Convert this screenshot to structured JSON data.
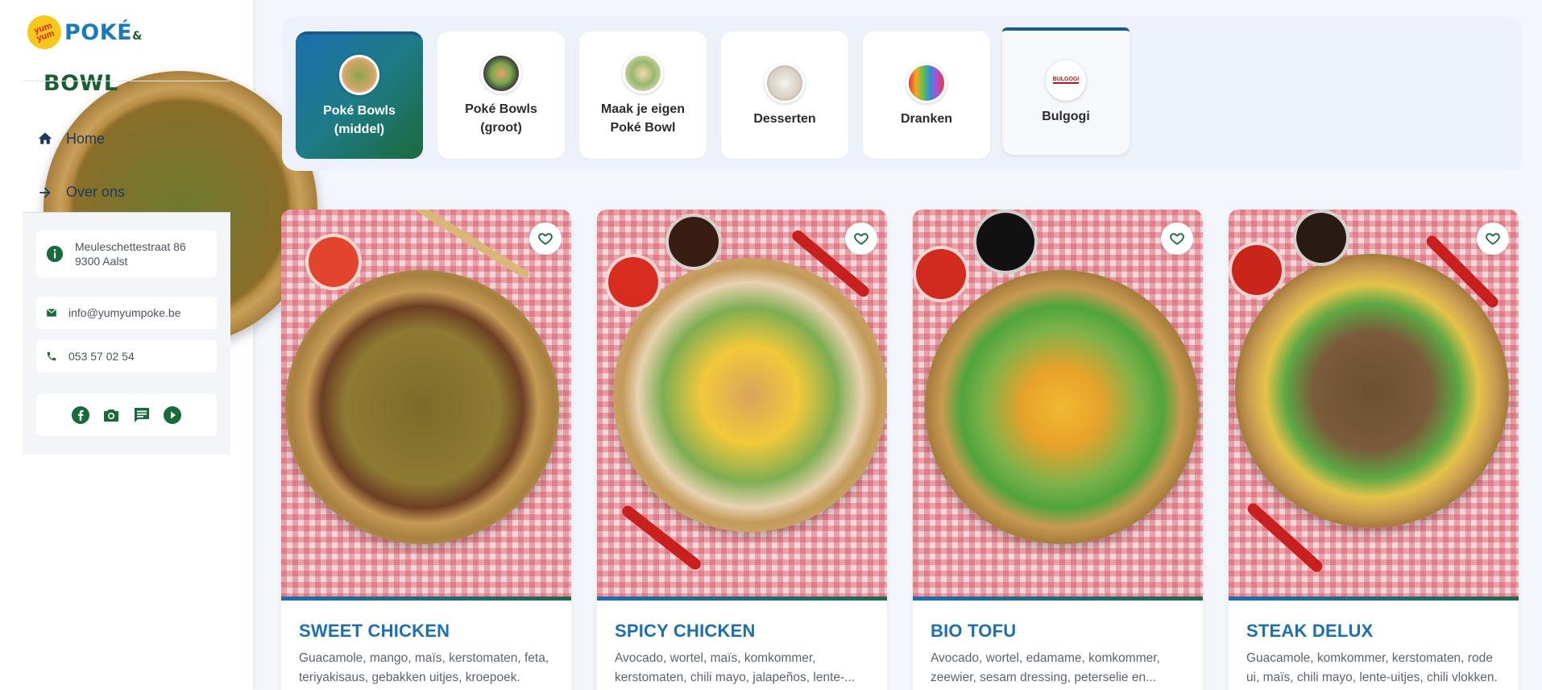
{
  "brand": {
    "mark": "yum yum",
    "name_part1": "POKÉ",
    "amp": "&",
    "name_part2": "BOWL",
    "colors": {
      "blue": "#1b7bb8",
      "green": "#1a5f32",
      "yellow": "#f7c71b",
      "red": "#d6261f"
    }
  },
  "nav": {
    "home": {
      "label": "Home",
      "icon": "home-icon"
    },
    "over": {
      "label": "Over ons",
      "icon": "arrow-right-icon"
    }
  },
  "contact": {
    "address_line1": "Meuleschettestraat 86",
    "address_line2": "9300 Aalst",
    "email": "info@yumyumpoke.be",
    "phone": "053 57 02 54",
    "social": [
      "facebook-icon",
      "camera-icon",
      "chat-icon",
      "play-icon"
    ]
  },
  "categories": [
    {
      "label": "Poké Bowls\n(middel)",
      "active": true
    },
    {
      "label": "Poké Bowls\n(groot)",
      "active": false
    },
    {
      "label": "Maak je eigen\nPoké Bowl",
      "active": false
    },
    {
      "label": "Desserten",
      "active": false
    },
    {
      "label": "Dranken",
      "active": false
    },
    {
      "label": "Bulgogi",
      "active": false
    }
  ],
  "products": [
    {
      "title": "SWEET CHICKEN",
      "desc": "Guacamole, mango, maïs, kerstomaten, feta, teriyakisaus, gebakken uitjes, kroepoek."
    },
    {
      "title": "SPICY CHICKEN",
      "desc": "Avocado, wortel, maïs, komkommer, kerstomaten, chili mayo, jalapeños, lente-..."
    },
    {
      "title": "BIO TOFU",
      "desc": "Avocado, wortel, edamame, komkommer, zeewier, sesam dressing, peterselie en..."
    },
    {
      "title": "STEAK DELUX",
      "desc": "Guacamole, komkommer, kerstomaten, rode ui, maïs, chili mayo, lente-uitjes, chili vlokken."
    }
  ],
  "thumb_text": {
    "bulgogi": "BULGOGI"
  }
}
